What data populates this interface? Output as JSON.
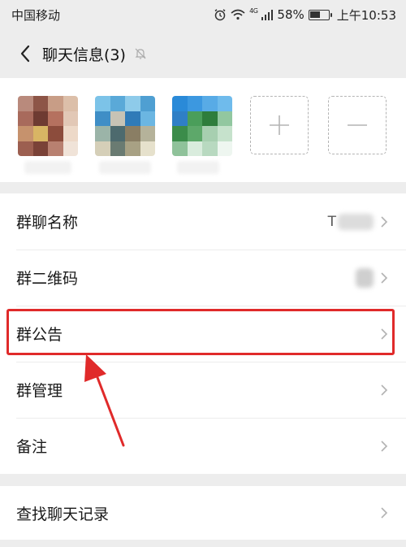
{
  "status_bar": {
    "carrier": "中国移动",
    "network_tag": "4G",
    "battery": "58%",
    "battery_level": 0.58,
    "time": "上午10:53"
  },
  "header": {
    "title": "聊天信息(3)"
  },
  "members": {
    "items": [
      {
        "icon": "member-avatar"
      },
      {
        "icon": "member-avatar"
      },
      {
        "icon": "member-avatar"
      }
    ],
    "add_icon": "plus-icon",
    "remove_icon": "minus-icon"
  },
  "settings": {
    "group_name": {
      "label": "群聊名称",
      "value": "T"
    },
    "qr_code": {
      "label": "群二维码"
    },
    "announcement": {
      "label": "群公告"
    },
    "management": {
      "label": "群管理"
    },
    "remark": {
      "label": "备注"
    }
  },
  "search": {
    "label": "查找聊天记录"
  },
  "colors": {
    "annotation": "#e02a2a",
    "background": "#ededed"
  }
}
